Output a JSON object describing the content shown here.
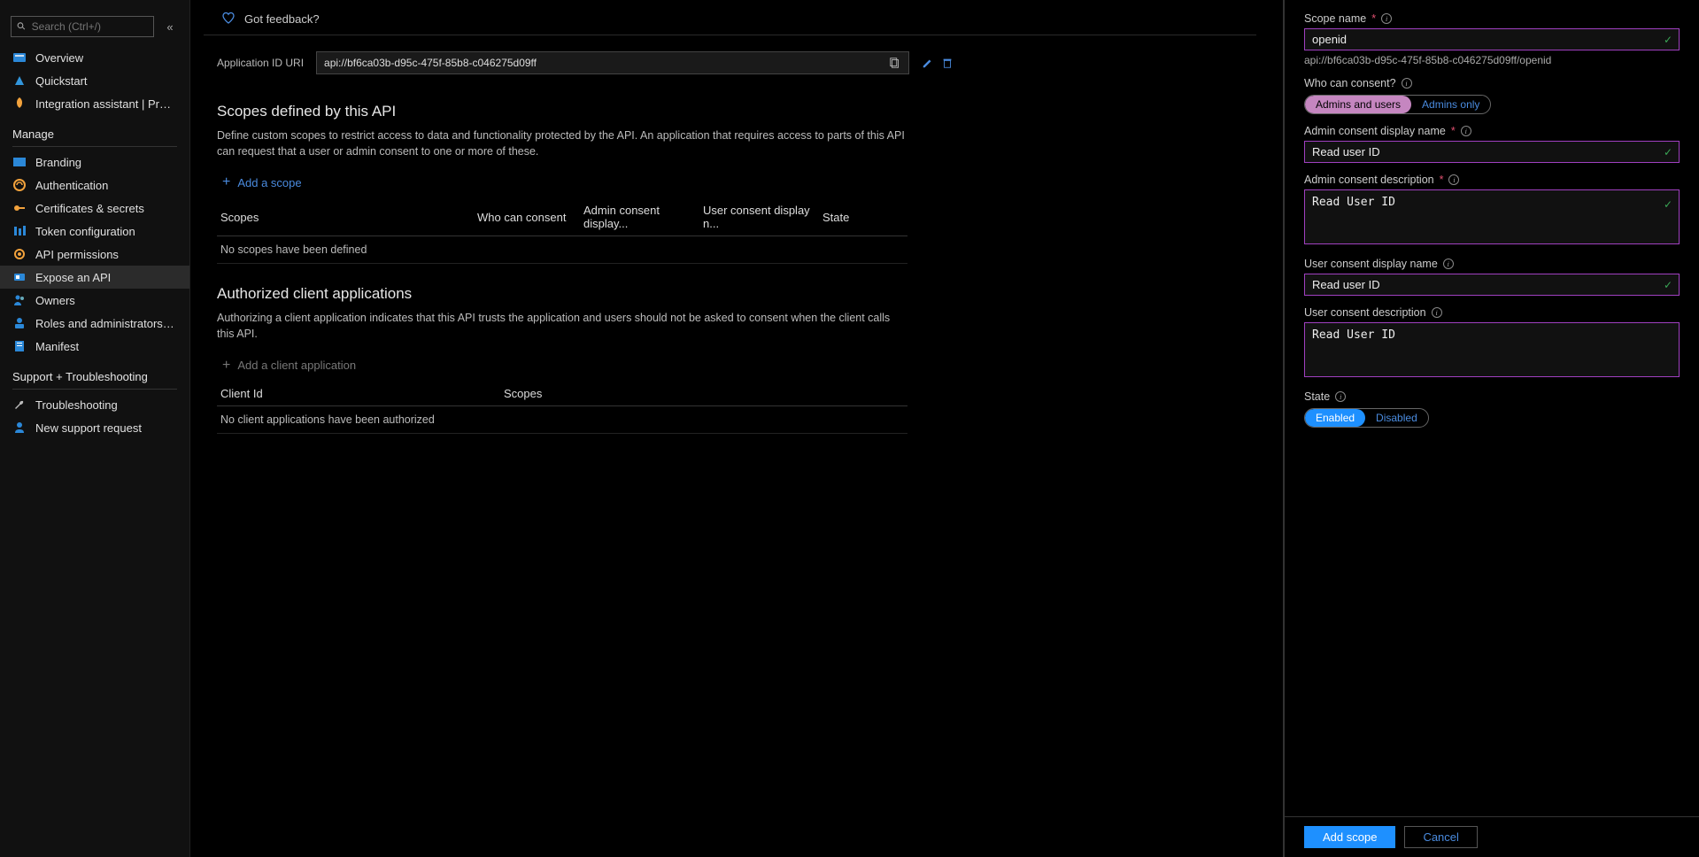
{
  "sidebar": {
    "search_placeholder": "Search (Ctrl+/)",
    "items_top": [
      {
        "label": "Overview"
      },
      {
        "label": "Quickstart"
      },
      {
        "label": "Integration assistant | Preview"
      }
    ],
    "manage_heading": "Manage",
    "items_manage": [
      {
        "label": "Branding"
      },
      {
        "label": "Authentication"
      },
      {
        "label": "Certificates & secrets"
      },
      {
        "label": "Token configuration"
      },
      {
        "label": "API permissions"
      },
      {
        "label": "Expose an API"
      },
      {
        "label": "Owners"
      },
      {
        "label": "Roles and administrators | Previ..."
      },
      {
        "label": "Manifest"
      }
    ],
    "support_heading": "Support + Troubleshooting",
    "items_support": [
      {
        "label": "Troubleshooting"
      },
      {
        "label": "New support request"
      }
    ]
  },
  "main": {
    "feedback_label": "Got feedback?",
    "app_id_label": "Application ID URI",
    "app_id_value": "api://bf6ca03b-d95c-475f-85b8-c046275d09ff",
    "scopes_section": {
      "title": "Scopes defined by this API",
      "desc": "Define custom scopes to restrict access to data and functionality protected by the API. An application that requires access to parts of this API can request that a user or admin consent to one or more of these.",
      "add_label": "Add a scope",
      "cols": [
        "Scopes",
        "Who can consent",
        "Admin consent display...",
        "User consent display n...",
        "State"
      ],
      "empty": "No scopes have been defined"
    },
    "clients_section": {
      "title": "Authorized client applications",
      "desc": "Authorizing a client application indicates that this API trusts the application and users should not be asked to consent when the client calls this API.",
      "add_label": "Add a client application",
      "cols": [
        "Client Id",
        "Scopes"
      ],
      "empty": "No client applications have been authorized"
    }
  },
  "panel": {
    "scope_name_label": "Scope name",
    "scope_name_value": "openid",
    "scope_path": "api://bf6ca03b-d95c-475f-85b8-c046275d09ff/openid",
    "consent_label": "Who can consent?",
    "consent_opt1": "Admins and users",
    "consent_opt2": "Admins only",
    "admin_display_label": "Admin consent display name",
    "admin_display_value": "Read user ID",
    "admin_desc_label": "Admin consent description",
    "admin_desc_value": "Read User ID",
    "user_display_label": "User consent display name",
    "user_display_value": "Read user ID",
    "user_desc_label": "User consent description",
    "user_desc_value": "Read User ID",
    "state_label": "State",
    "state_opt1": "Enabled",
    "state_opt2": "Disabled",
    "add_btn": "Add scope",
    "cancel_btn": "Cancel"
  }
}
